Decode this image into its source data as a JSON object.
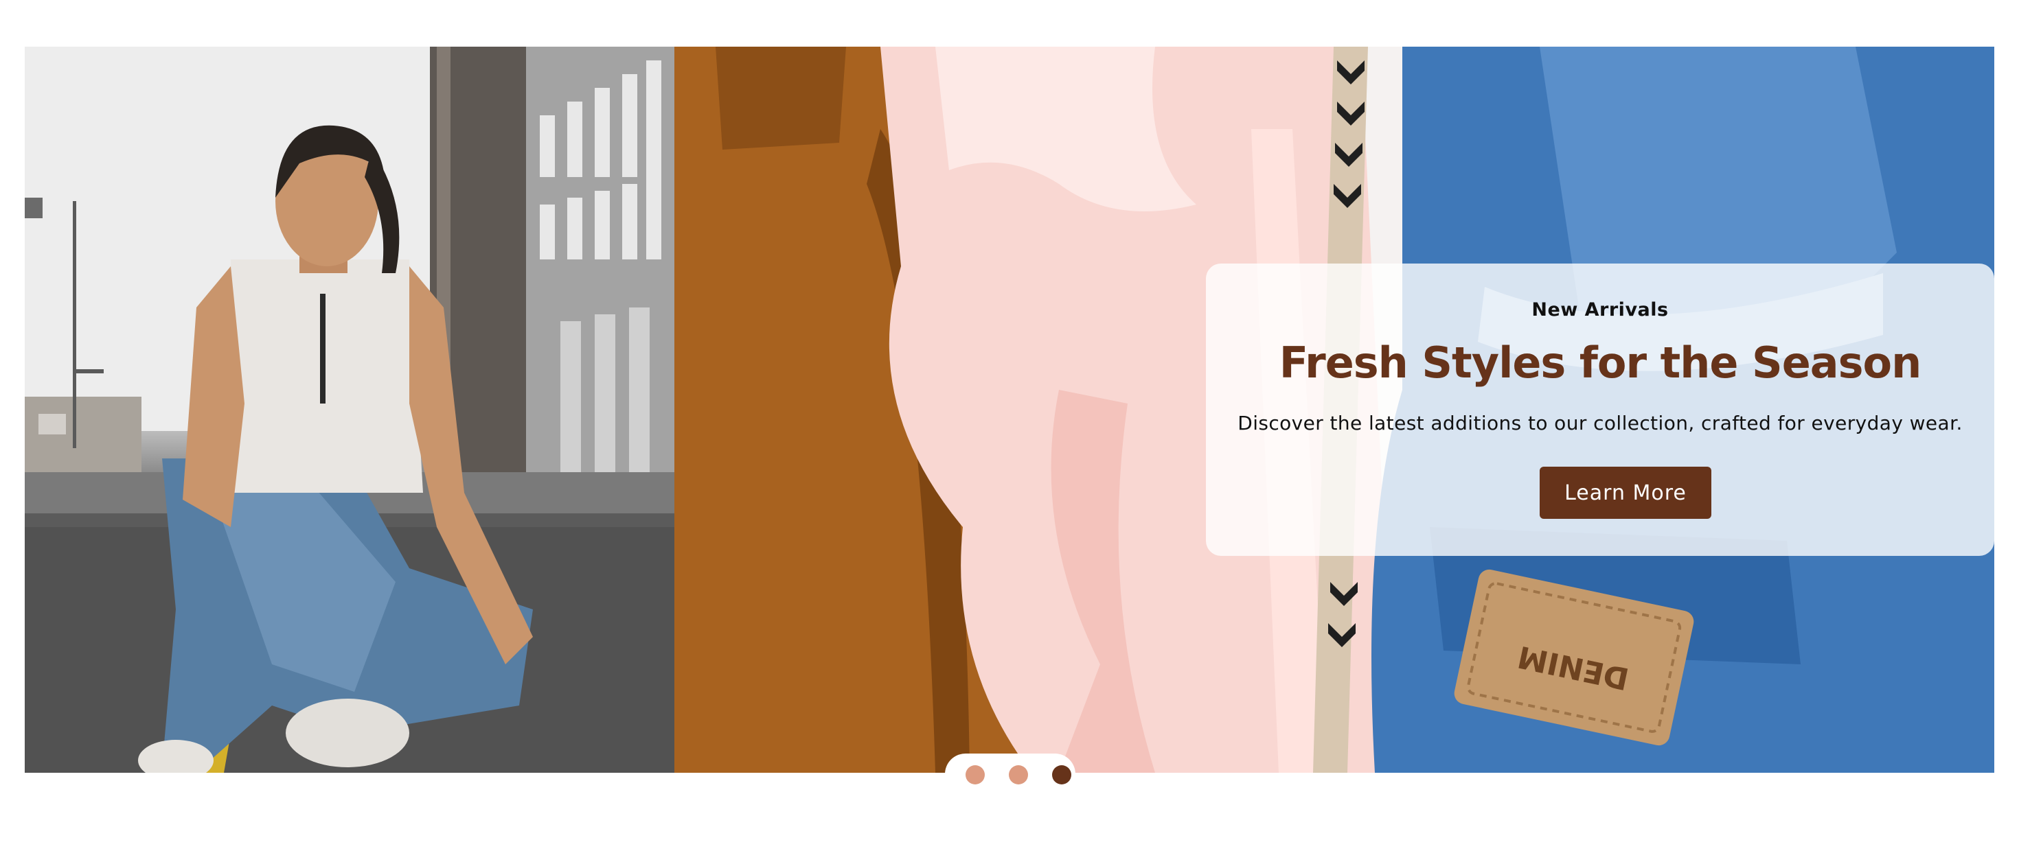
{
  "hero": {
    "eyebrow": "New Arrivals",
    "headline": "Fresh Styles for the Season",
    "description": "Discover the latest additions to our collection, crafted for everyday wear.",
    "cta_label": "Learn More",
    "denim_label_text": "DENIM"
  },
  "colors": {
    "accent": "#66331a",
    "dot_inactive": "#dd9a7f",
    "dot_active": "#66331a"
  },
  "carousel": {
    "slide_count": 3,
    "active_index": 2
  }
}
